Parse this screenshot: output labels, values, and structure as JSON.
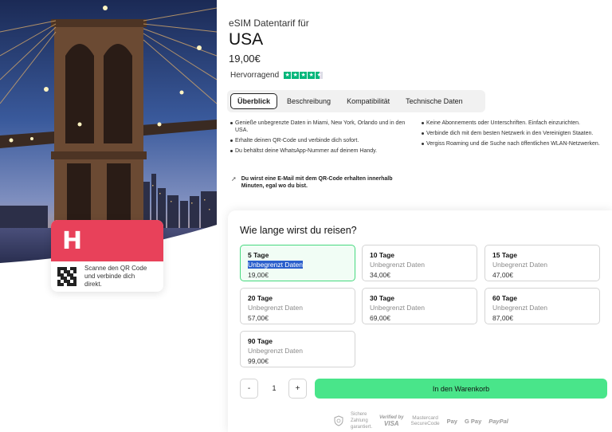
{
  "product": {
    "eyebrow": "eSIM Datentarif für",
    "title": "USA",
    "price": "19,00€",
    "rating_label": "Hervorragend",
    "rating_stars": 4.5
  },
  "brand": {
    "logo": "H",
    "qr_text": "Scanne den QR Code und verbinde dich direkt."
  },
  "tabs": [
    {
      "label": "Überblick",
      "active": true
    },
    {
      "label": "Beschreibung",
      "active": false
    },
    {
      "label": "Kompatibilität",
      "active": false
    },
    {
      "label": "Technische Daten",
      "active": false
    }
  ],
  "features_left": [
    "Genieße unbegrenzte Daten in Miami, New York, Orlando und in den USA.",
    "Erhalte deinen QR-Code und verbinde dich sofort.",
    "Du behältst deine WhatsApp-Nummer auf deinem Handy."
  ],
  "features_right": [
    "Keine Abonnements oder Unterschriften. Einfach einzurichten.",
    "Verbinde dich mit dem besten Netzwerk in den Vereinigten Staaten.",
    "Vergiss Roaming und die Suche nach öffentlichen WLAN-Netzwerken."
  ],
  "email_note": "Du wirst eine E-Mail mit dem QR-Code erhalten innerhalb Minuten, egal wo du bist.",
  "duration": {
    "title": "Wie lange wirst du reisen?",
    "plans": [
      {
        "days": "5 Tage",
        "data": "Unbegrenzt Daten",
        "price": "19,00€",
        "selected": true
      },
      {
        "days": "10 Tage",
        "data": "Unbegrenzt Daten",
        "price": "34,00€",
        "selected": false
      },
      {
        "days": "15 Tage",
        "data": "Unbegrenzt Daten",
        "price": "47,00€",
        "selected": false
      },
      {
        "days": "20 Tage",
        "data": "Unbegrenzt Daten",
        "price": "57,00€",
        "selected": false
      },
      {
        "days": "30 Tage",
        "data": "Unbegrenzt Daten",
        "price": "69,00€",
        "selected": false
      },
      {
        "days": "60 Tage",
        "data": "Unbegrenzt Daten",
        "price": "87,00€",
        "selected": false
      },
      {
        "days": "90 Tage",
        "data": "Unbegrenzt Daten",
        "price": "99,00€",
        "selected": false
      }
    ],
    "quantity": "1",
    "minus_label": "-",
    "plus_label": "+",
    "cart_label": "In den Warenkorb"
  },
  "payments": {
    "secure_1": "Sichere",
    "secure_2": "Zahlung",
    "secure_3": "garantiert.",
    "verified_1": "Verified by",
    "verified_2": "VISA",
    "mc_1": "Mastercard",
    "mc_2": "SecureCode",
    "apple": "Pay",
    "google": "G Pay",
    "paypal": "PayPal"
  },
  "colors": {
    "brand": "#e8415a",
    "cta": "#49e58a",
    "trustpilot": "#00b67a"
  }
}
